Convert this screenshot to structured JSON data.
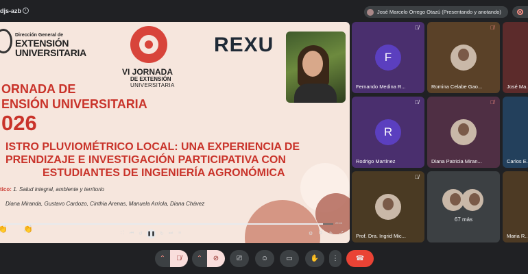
{
  "meeting": {
    "code": "djs-azb"
  },
  "presenter_chip": {
    "text": "José Marcelo Orrego Otazú (Presentando y anotando)"
  },
  "slide": {
    "org_line1": "Dirección General de",
    "org_line2": "EXTENSIÓN",
    "org_line3": "UNIVERSITARIA",
    "jornada_line1": "VI JORNADA",
    "jornada_line2": "DE EXTENSIÓN",
    "jornada_line3": "UNIVERSITARIA",
    "brand": "REXU",
    "title_line1": "ORNADA DE",
    "title_line2": "ENSIÓN UNIVERSITARIA",
    "title_line3": "026",
    "subtitle_line1": "ISTRO PLUVIOMÉTRICO LOCAL: UNA EXPERIENCIA DE",
    "subtitle_line2": "PRENDIZAJE E INVESTIGACIÓN PARTICIPATIVA CON",
    "subtitle_line3": "ESTUDIANTES DE INGENIERÍA AGRONÓMICA",
    "eje_label": "tico:",
    "eje_value": "1. Salud integral, ambiente y territorio",
    "authors": "Diana Miranda, Gustavo Cardozo, Cinthia Arenas, Manuela Arriola, Diana Chávez"
  },
  "playback": {
    "progress_fraction": 0.97,
    "time": "29:46"
  },
  "participants": [
    {
      "name": "Fernando Medina R...",
      "initial": "F"
    },
    {
      "name": "Romina Celabe Gao..."
    },
    {
      "name": "José Ma..."
    },
    {
      "name": "Rodrigo Martínez",
      "initial": "R"
    },
    {
      "name": "Diana Patricia Miran..."
    },
    {
      "name": "Carlos E..."
    },
    {
      "name": "Prof. Dra. Ingrid Mic..."
    },
    {
      "name": "Maria R..."
    }
  ],
  "more_tile": {
    "label": "67 más"
  },
  "colors": {
    "accent_red": "#c9332a",
    "end_call": "#ea4335",
    "letter_avatar": "#5b3fbf"
  },
  "icons": {
    "mic_off": "mic-off-icon",
    "camera_off": "camera-off-icon",
    "present": "present-screen-icon",
    "emoji": "emoji-icon",
    "captions": "captions-icon",
    "raise_hand": "hand-icon",
    "more": "more-vert-icon",
    "end_call": "call-end-icon"
  }
}
